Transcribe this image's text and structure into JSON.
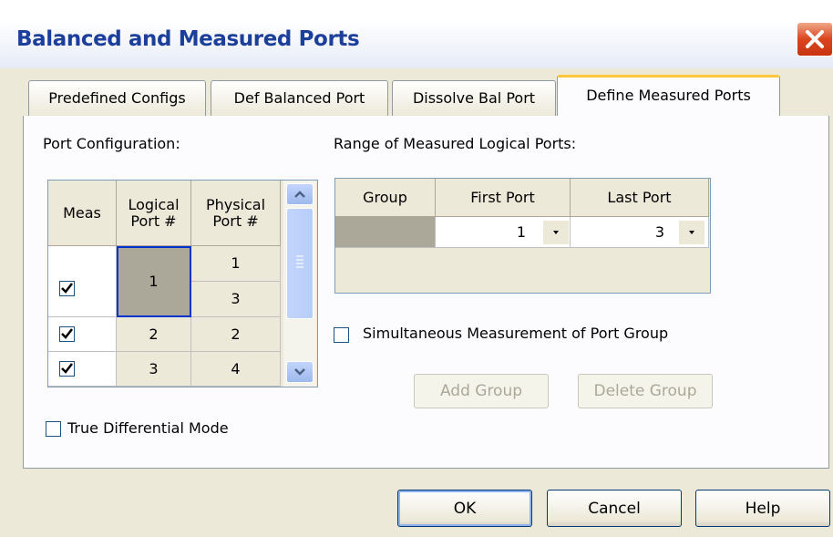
{
  "window": {
    "title": "Balanced and Measured Ports"
  },
  "tabs": [
    {
      "label": "Predefined Configs"
    },
    {
      "label": "Def Balanced Port"
    },
    {
      "label": "Dissolve Bal Port"
    },
    {
      "label": "Define Measured Ports"
    }
  ],
  "port_config": {
    "label": "Port Configuration:",
    "headers": {
      "meas": "Meas",
      "logical": "Logical\nPort #",
      "physical": "Physical\nPort #"
    },
    "rows": [
      {
        "meas": true,
        "logical": "1",
        "physical": [
          "1",
          "3"
        ]
      },
      {
        "meas": true,
        "logical": "2",
        "physical": [
          "2"
        ]
      },
      {
        "meas": true,
        "logical": "3",
        "physical": [
          "4"
        ]
      }
    ]
  },
  "true_diff": {
    "label": "True Differential Mode",
    "checked": false
  },
  "range": {
    "label": "Range of Measured Logical Ports:",
    "headers": {
      "group": "Group",
      "first": "First Port",
      "last": "Last Port"
    },
    "row": {
      "group": "",
      "first": "1",
      "last": "3"
    }
  },
  "simultaneous": {
    "label": "Simultaneous Measurement of Port Group",
    "checked": false
  },
  "group_buttons": {
    "add": "Add Group",
    "delete": "Delete Group"
  },
  "buttons": {
    "ok": "OK",
    "cancel": "Cancel",
    "help": "Help"
  },
  "colors": {
    "title": "#1c3f9c",
    "active_tab_accent": "#ffc83c",
    "selection_border": "#0033cc",
    "close_button": "#d9451d"
  }
}
